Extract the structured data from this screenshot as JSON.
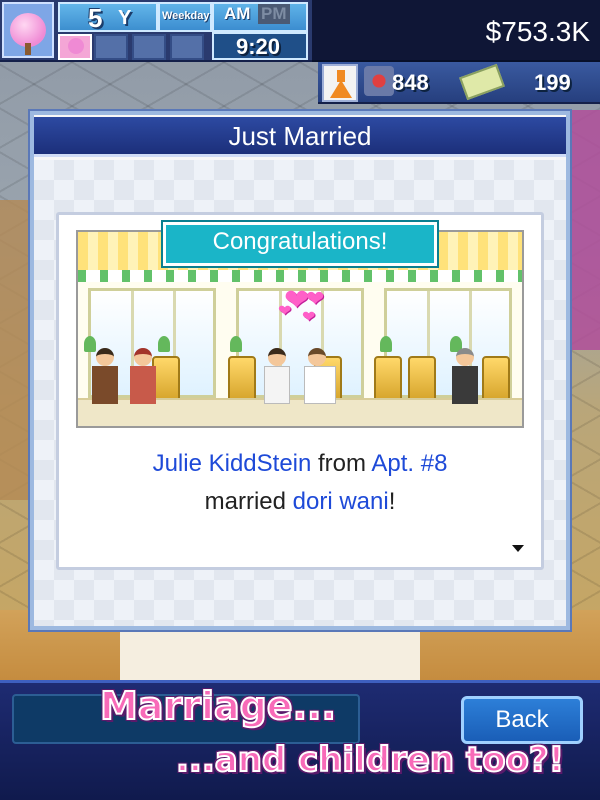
{
  "hud": {
    "year_number": "5",
    "year_unit": "Y",
    "weekday": "Weekday",
    "am": "AM",
    "pm": "PM",
    "time": "9:20",
    "money": "$753.3K",
    "research_points": "848",
    "cash_items": "199",
    "active_period": "AM"
  },
  "dialog": {
    "title": "Just Married",
    "scene_label": "Congratulations!",
    "message": {
      "name": "Julie KiddStein",
      "from": "from",
      "location": "Apt. #8",
      "married": "married",
      "spouse": "dori wani",
      "end": "!"
    }
  },
  "bottom": {
    "back_label": "Back"
  },
  "promo": {
    "line1": "Marriage...",
    "line2": "...and children too?!"
  },
  "colors": {
    "header_blue": "#1c2f7a",
    "highlight_text": "#1e4ad8",
    "label_cyan": "#1ab5c8",
    "promo_pink": "#f86ab8"
  },
  "icons": [
    "sakura-tree-icon",
    "flask-icon",
    "research-icon",
    "cash-icon",
    "more-arrow-icon",
    "heart-icon"
  ]
}
